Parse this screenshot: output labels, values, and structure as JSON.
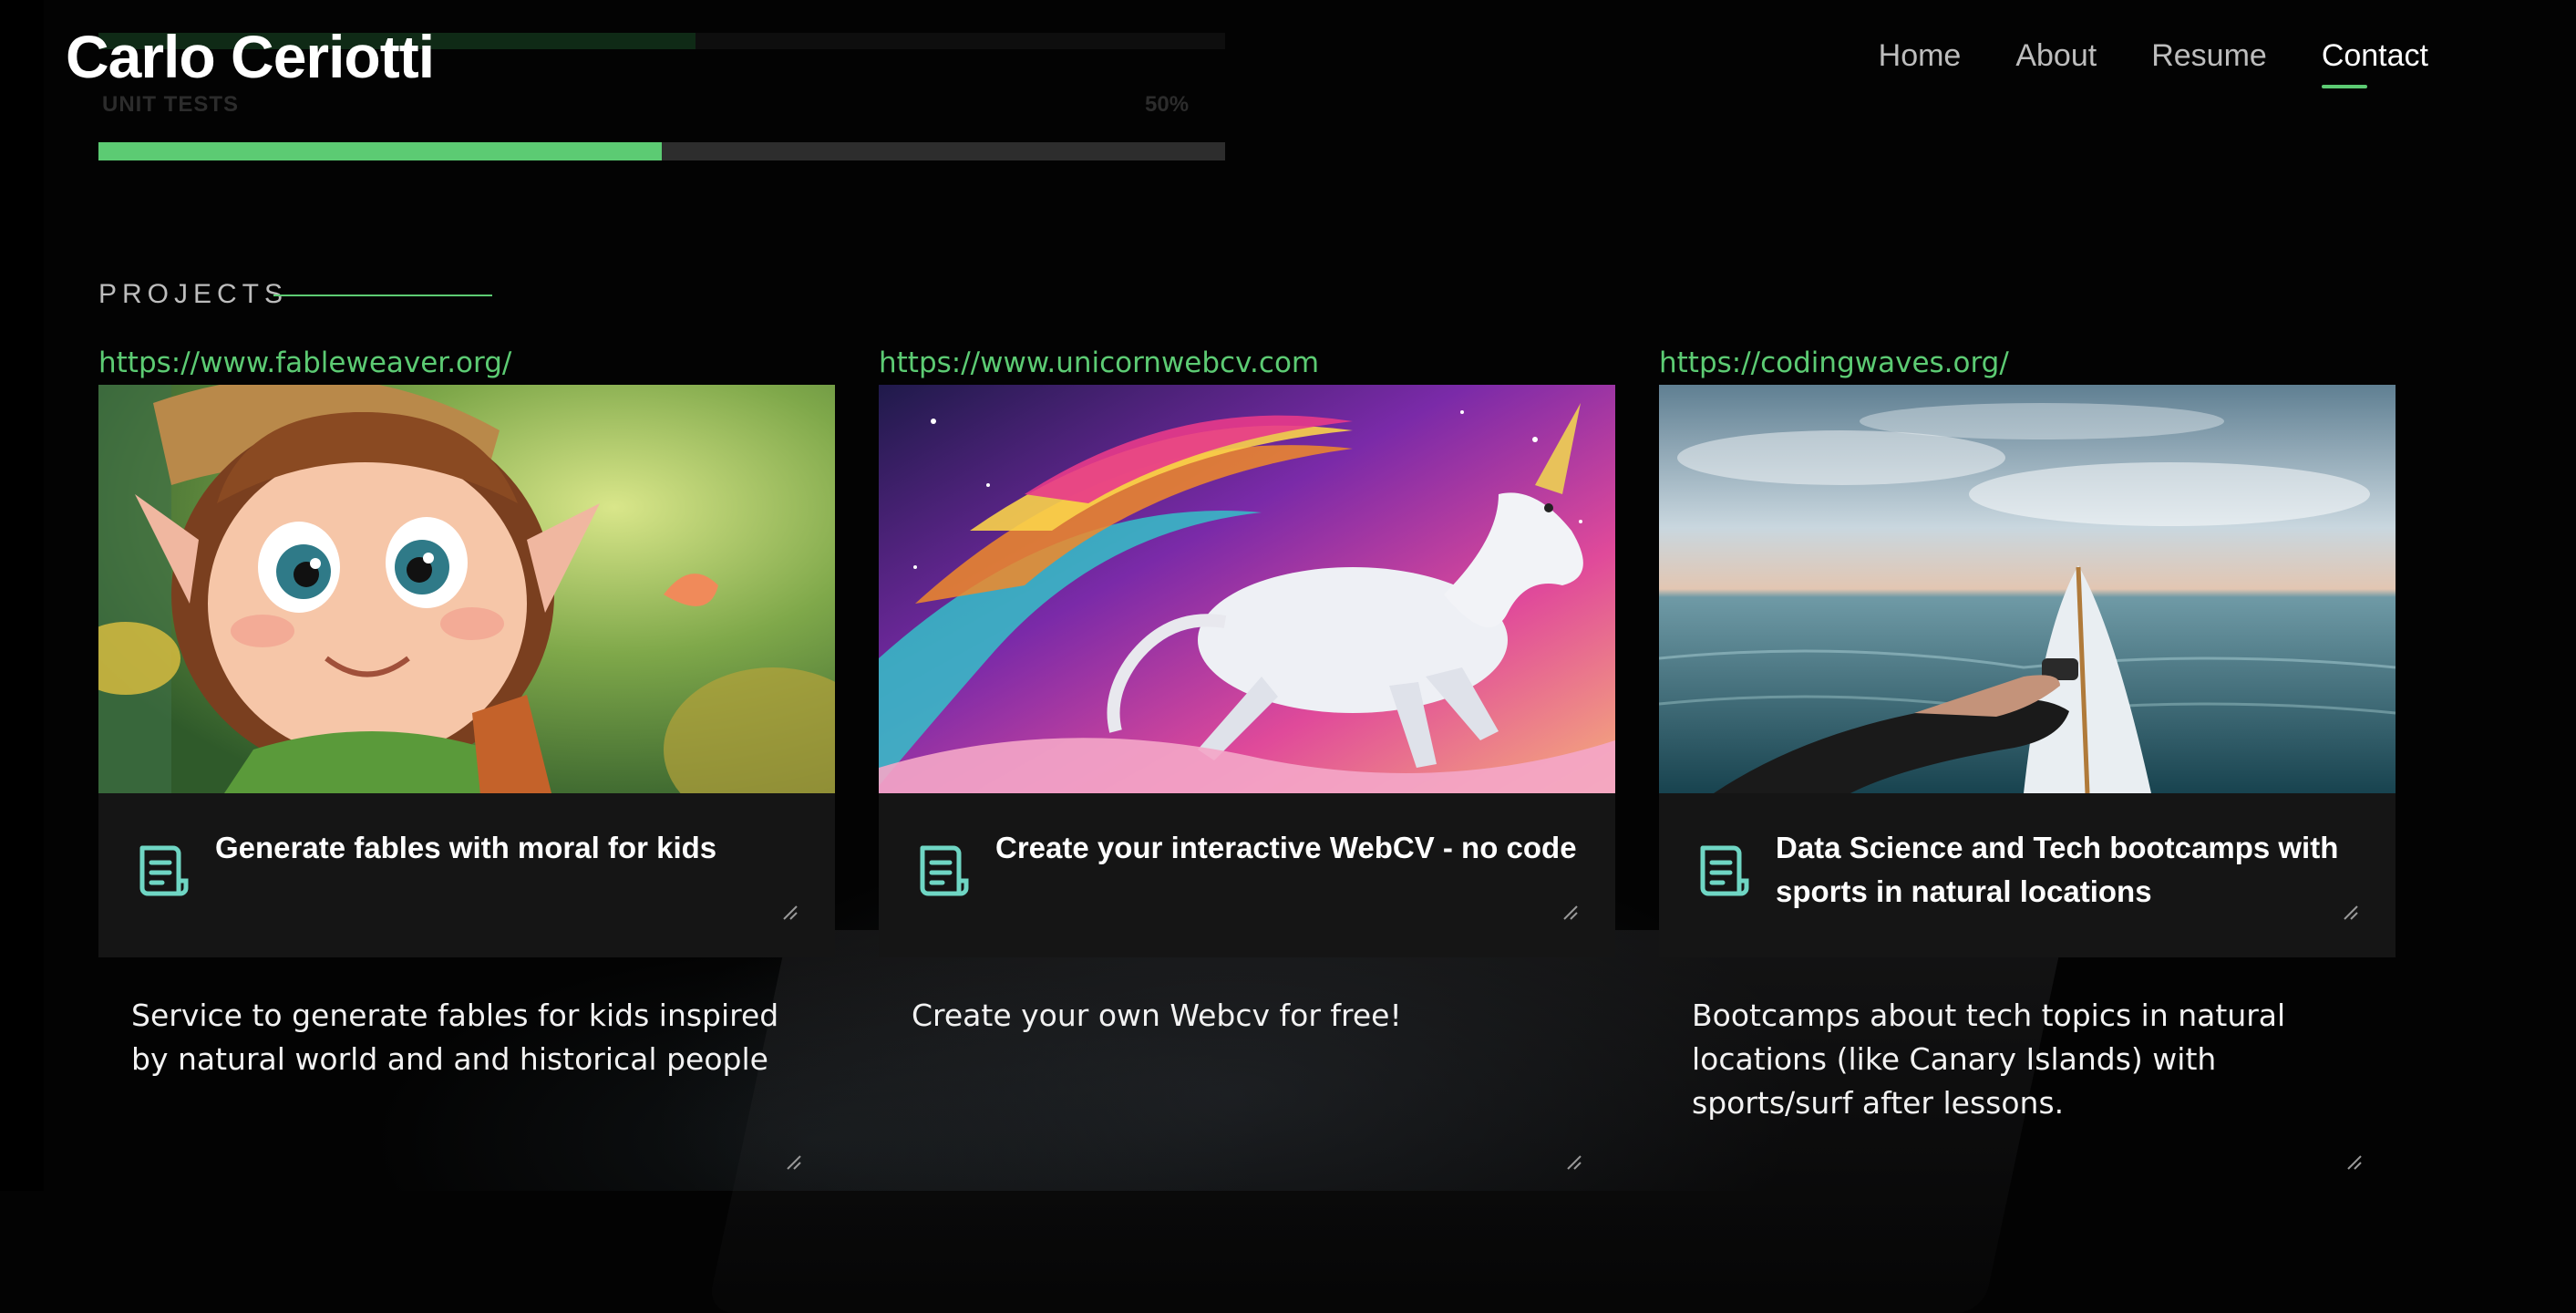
{
  "header": {
    "brand": "Carlo Ceriotti",
    "nav": [
      {
        "label": "Home",
        "active": false
      },
      {
        "label": "About",
        "active": false
      },
      {
        "label": "Resume",
        "active": false
      },
      {
        "label": "Contact",
        "active": true
      }
    ]
  },
  "skills": [
    {
      "label": "UNIT TESTS",
      "percent_label": "50%",
      "value": 0.5
    }
  ],
  "projects_section": {
    "title": "PROJECTS",
    "items": [
      {
        "url": "https://www.fableweaver.org/",
        "image": "elf-girl-forest-illustration",
        "title": "Generate fables with moral for kids",
        "description": "Service to generate fables for kids inspired by natural world and and historical people"
      },
      {
        "url": "https://www.unicornwebcv.com",
        "image": "rainbow-unicorn-galaxy-illustration",
        "title": "Create your interactive WebCV - no code",
        "description": "Create your own Webcv for free!"
      },
      {
        "url": "https://codingwaves.org/",
        "image": "surfboard-ocean-photo",
        "title": "Data Science and Tech bootcamps with sports in natural locations",
        "description": "Bootcamps about tech topics in natural locations (like Canary Islands) with sports/surf after lessons."
      }
    ]
  },
  "colors": {
    "accent": "#5ccb73",
    "background": "#030303",
    "card_bar": "#151515",
    "icon": "#6fd6c4"
  },
  "icons": {
    "project_card": "document-icon",
    "resize": "resize-handle-icon"
  }
}
